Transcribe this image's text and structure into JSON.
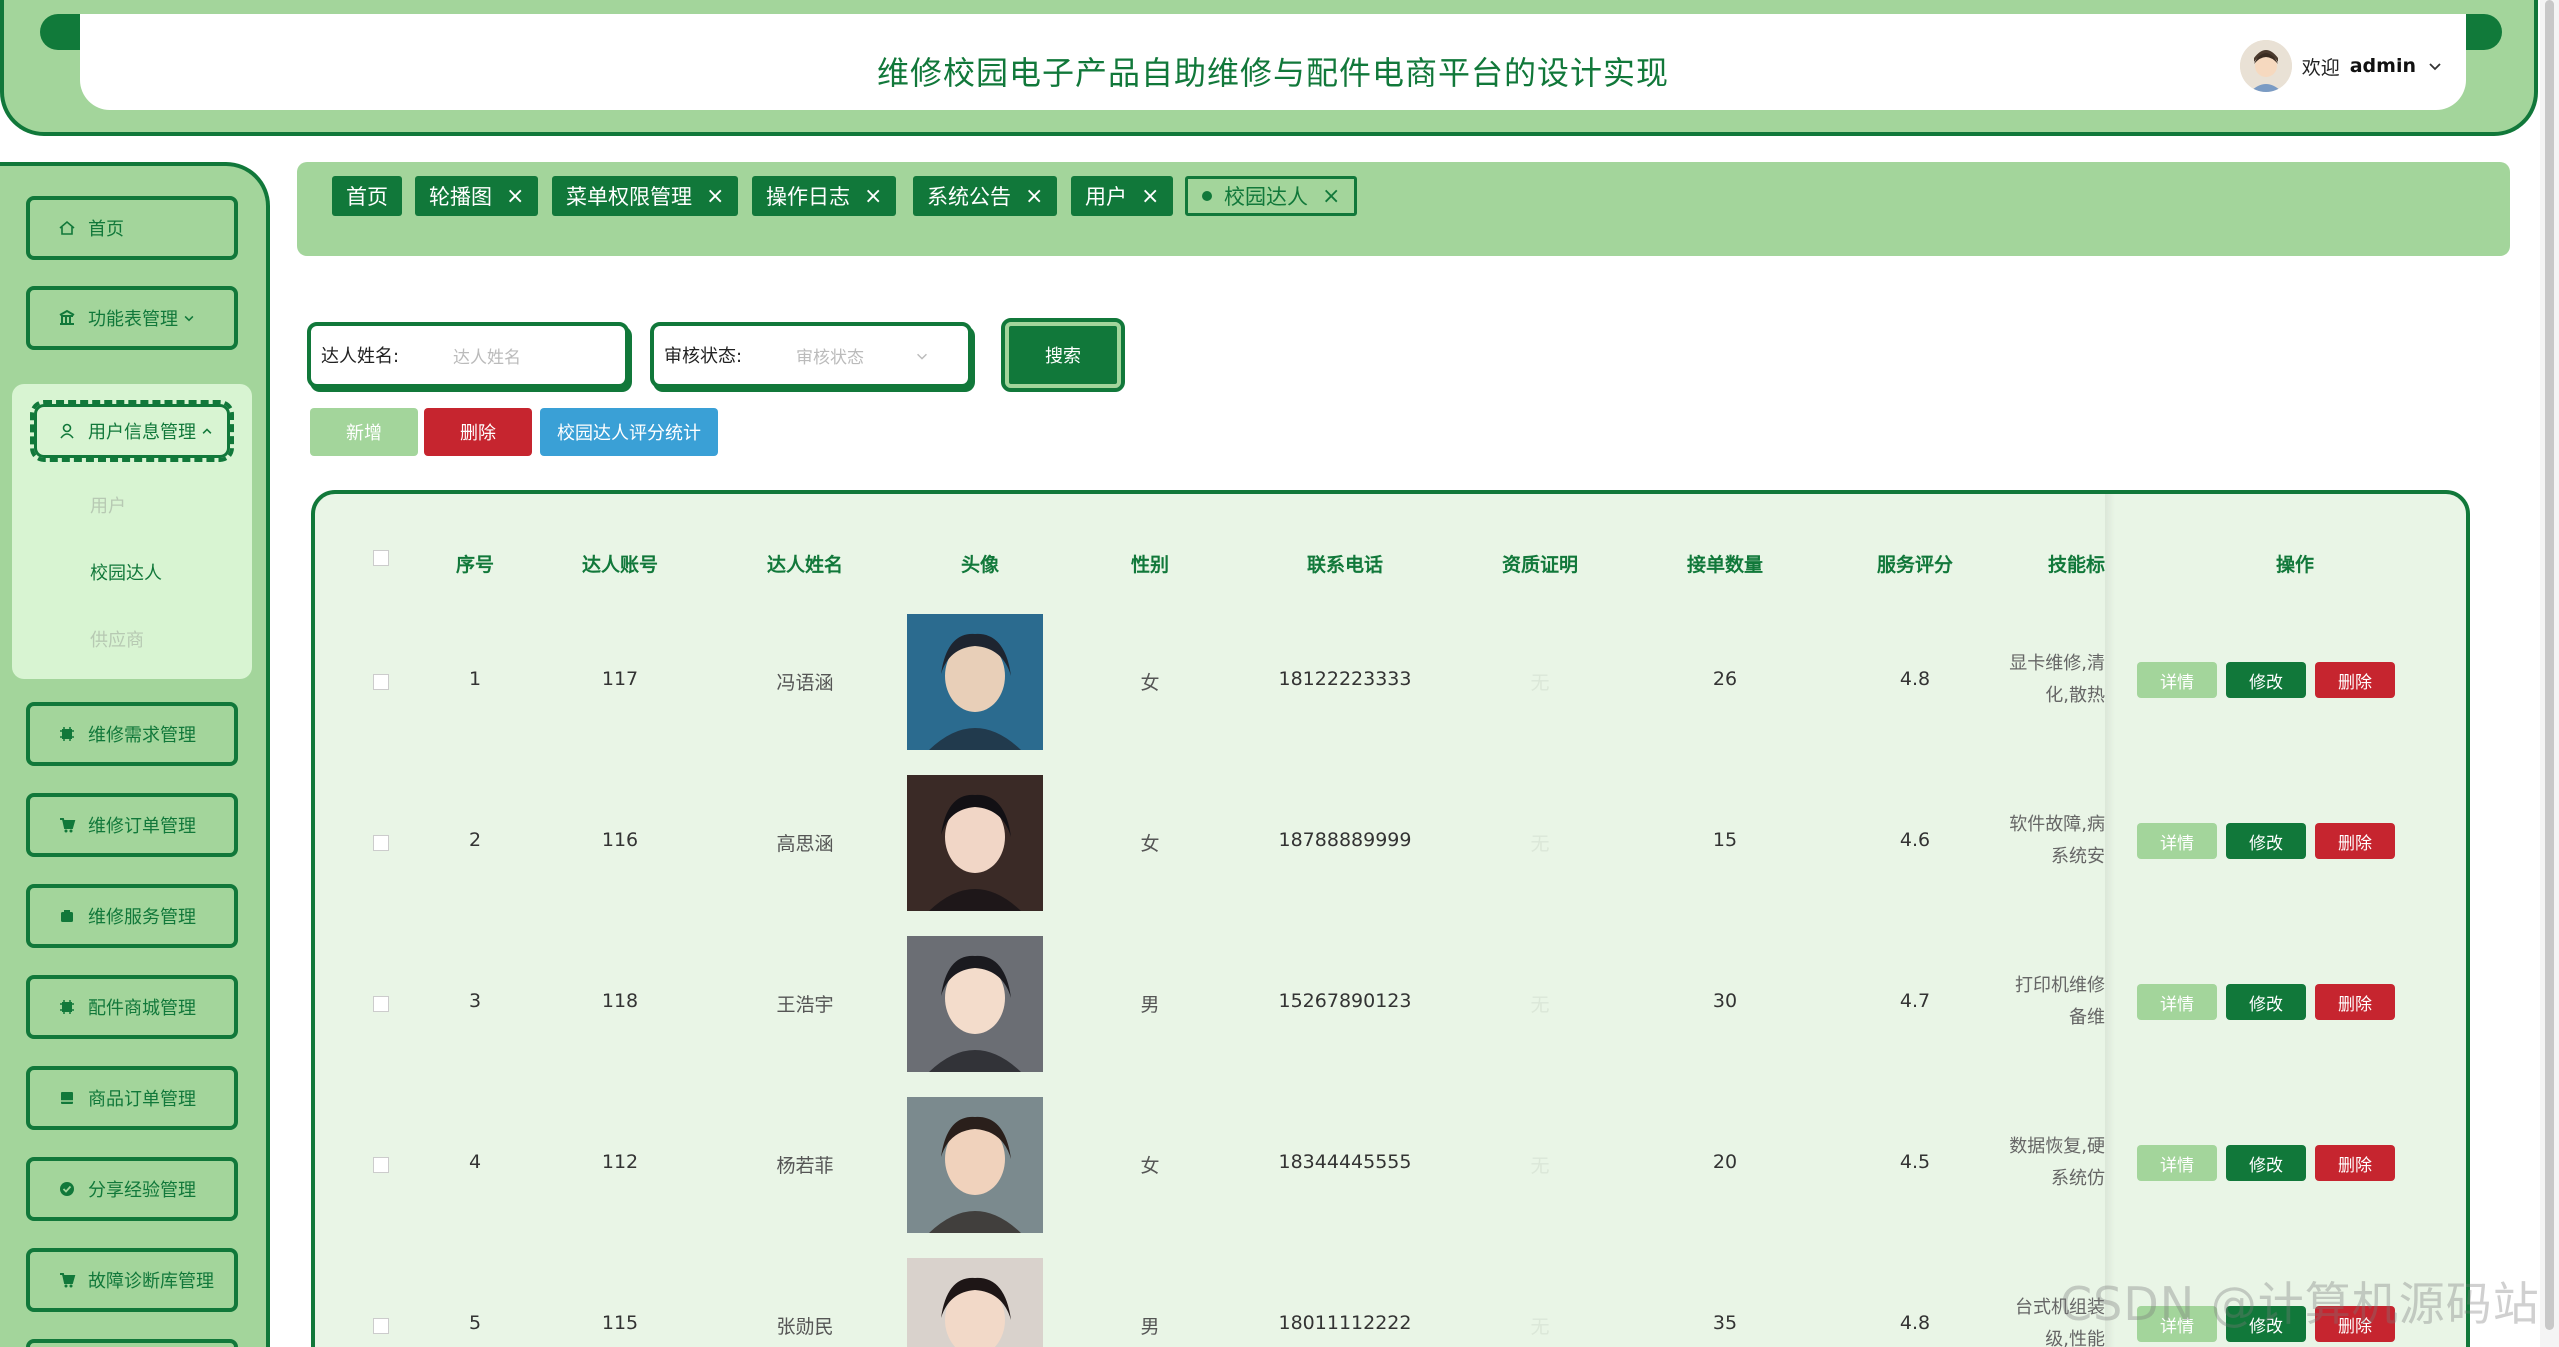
{
  "header": {
    "title": "维修校园电子产品自助维修与配件电商平台的设计实现",
    "welcome": "欢迎",
    "username": "admin"
  },
  "sidebar": {
    "items_top": [
      {
        "label": "首页",
        "icon": "home-icon"
      },
      {
        "label": "功能表管理",
        "icon": "bank-icon"
      }
    ],
    "active_group": {
      "label": "用户信息管理",
      "icon": "user-icon",
      "subitems": [
        "用户",
        "校园达人",
        "供应商"
      ]
    },
    "items_bottom": [
      {
        "label": "维修需求管理",
        "icon": "chip-icon"
      },
      {
        "label": "维修订单管理",
        "icon": "cart-icon"
      },
      {
        "label": "维修服务管理",
        "icon": "tools-icon"
      },
      {
        "label": "配件商城管理",
        "icon": "chip-icon"
      },
      {
        "label": "商品订单管理",
        "icon": "list-icon"
      },
      {
        "label": "分享经验管理",
        "icon": "check-circle-icon"
      },
      {
        "label": "故障诊断库管理",
        "icon": "cart-icon"
      }
    ]
  },
  "tags": [
    "首页",
    "轮播图",
    "菜单权限管理",
    "操作日志",
    "系统公告",
    "用户",
    "校园达人"
  ],
  "search": {
    "name_label": "达人姓名:",
    "name_placeholder": "达人姓名",
    "status_label": "审核状态:",
    "status_placeholder": "审核状态",
    "button": "搜索"
  },
  "actions": {
    "add": "新增",
    "delete": "删除",
    "stats": "校园达人评分统计"
  },
  "table": {
    "columns": [
      "序号",
      "达人账号",
      "达人姓名",
      "头像",
      "性别",
      "联系电话",
      "资质证明",
      "接单数量",
      "服务评分",
      "技能标",
      "操作"
    ],
    "rows": [
      {
        "no": "1",
        "account": "117",
        "name": "冯语涵",
        "gender": "女",
        "phone": "18122223333",
        "cert": "无",
        "orders": "26",
        "score": "4.8",
        "skills": [
          "显卡维修,清",
          "化,散热"
        ]
      },
      {
        "no": "2",
        "account": "116",
        "name": "高思涵",
        "gender": "女",
        "phone": "18788889999",
        "cert": "无",
        "orders": "15",
        "score": "4.6",
        "skills": [
          "软件故障,病",
          "系统安"
        ]
      },
      {
        "no": "3",
        "account": "118",
        "name": "王浩宇",
        "gender": "男",
        "phone": "15267890123",
        "cert": "无",
        "orders": "30",
        "score": "4.7",
        "skills": [
          "打印机维修",
          "备维"
        ]
      },
      {
        "no": "4",
        "account": "112",
        "name": "杨若菲",
        "gender": "女",
        "phone": "18344445555",
        "cert": "无",
        "orders": "20",
        "score": "4.5",
        "skills": [
          "数据恢复,硬",
          "系统仿"
        ]
      },
      {
        "no": "5",
        "account": "115",
        "name": "张勋民",
        "gender": "男",
        "phone": "18011112222",
        "cert": "无",
        "orders": "35",
        "score": "4.8",
        "skills": [
          "台式机组装",
          "级,性能"
        ]
      }
    ],
    "op_detail": "详情",
    "op_edit": "修改",
    "op_delete": "删除"
  },
  "watermark": "CSDN @计算机源码站",
  "colors": {
    "primary": "#11783a",
    "light": "#a3d59b",
    "danger": "#c6252f",
    "info": "#3aa0d6",
    "pale": "#e9f5e6"
  }
}
